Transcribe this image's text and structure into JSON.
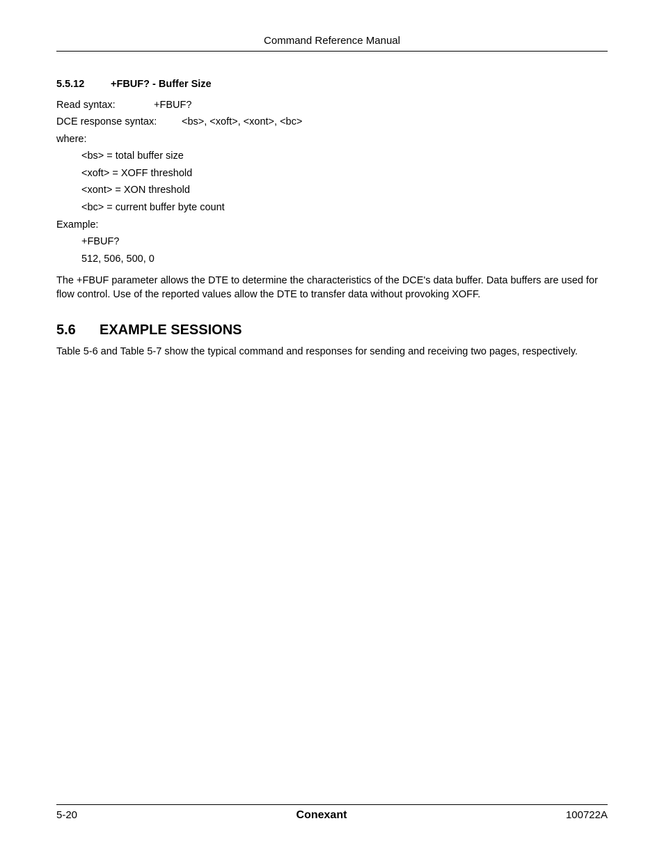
{
  "header": {
    "title": "Command Reference Manual"
  },
  "section_5_5_12": {
    "number": "5.5.12",
    "title": "+FBUF? - Buffer Size",
    "read_syntax_label": "Read syntax:",
    "read_syntax_value": "+FBUF?",
    "dce_response_label": "DCE response syntax:",
    "dce_response_value": "<bs>, <xoft>, <xont>, <bc>",
    "where_label": "where:",
    "definitions": [
      "<bs> = total buffer size",
      "<xoft> = XOFF threshold",
      "<xont> = XON threshold",
      "<bc> = current buffer byte count"
    ],
    "example_label": "Example:",
    "example_lines": [
      "+FBUF?",
      "512, 506, 500, 0"
    ],
    "paragraph": "The +FBUF parameter allows the DTE to determine the characteristics of the DCE's data buffer. Data buffers are used for flow control. Use of the reported values allow the DTE to transfer data without provoking XOFF."
  },
  "section_5_6": {
    "number": "5.6",
    "title": "EXAMPLE SESSIONS",
    "paragraph": "Table 5-6 and Table 5-7 show the typical command and responses for sending and receiving two pages, respectively."
  },
  "footer": {
    "left": "5-20",
    "center": "Conexant",
    "right": "100722A"
  }
}
